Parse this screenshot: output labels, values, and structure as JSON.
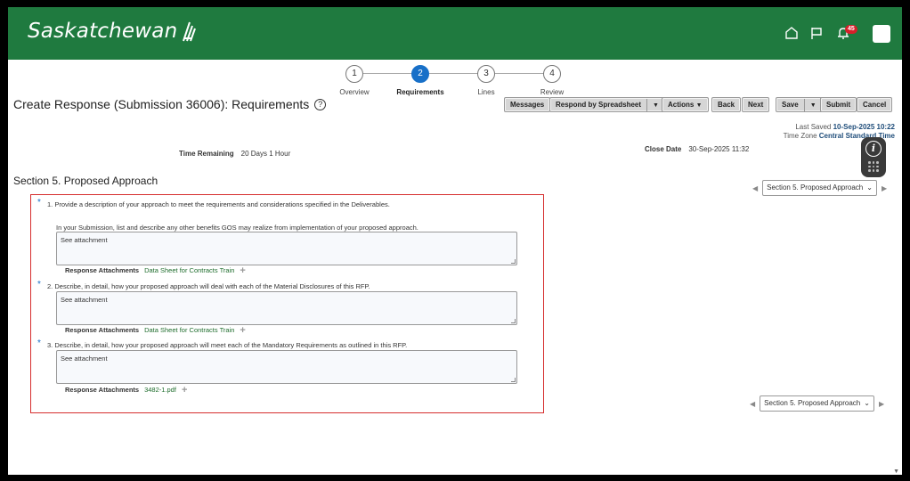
{
  "header": {
    "brand": "Saskatchewan",
    "notification_count": "45",
    "bg_color": "#1f7a3f"
  },
  "train": {
    "steps": [
      {
        "number": "1",
        "label": "Overview"
      },
      {
        "number": "2",
        "label": "Requirements"
      },
      {
        "number": "3",
        "label": "Lines"
      },
      {
        "number": "4",
        "label": "Review"
      }
    ],
    "active_index": 1
  },
  "page": {
    "title": "Create Response (Submission 36006): Requirements",
    "help_glyph": "?"
  },
  "toolbar": {
    "messages": "Messages",
    "respond_by_spreadsheet": "Respond by Spreadsheet",
    "actions": "Actions",
    "back": "Back",
    "next": "Next",
    "save": "Save",
    "submit": "Submit",
    "cancel": "Cancel"
  },
  "status": {
    "last_saved_label": "Last Saved",
    "last_saved_value": "10-Sep-2025 10:22",
    "time_zone_label": "Time Zone",
    "time_zone_value": "Central Standard Time",
    "time_remaining_label": "Time Remaining",
    "time_remaining_value": "20 Days 1 Hour",
    "close_date_label": "Close Date",
    "close_date_value": "30-Sep-2025 11:32"
  },
  "section": {
    "title": "Section 5. Proposed Approach",
    "selector_value": "Section 5. Proposed Approach"
  },
  "questions": [
    {
      "number": "1.",
      "text": "Provide a description of your approach to meet the requirements and considerations specified in the Deliverables.",
      "subtext": "In your Submission, list and describe any other benefits GOS may realize from implementation of your proposed approach.",
      "response": "See attachment",
      "attachments_label": "Response Attachments",
      "attachment": "Data Sheet for Contracts Train"
    },
    {
      "number": "2.",
      "text": "Describe, in detail, how your proposed approach will deal with each of the Material Disclosures of this RFP.",
      "subtext": "",
      "response": "See attachment",
      "attachments_label": "Response Attachments",
      "attachment": "Data Sheet for Contracts Train"
    },
    {
      "number": "3.",
      "text": "Describe, in detail, how your proposed approach will meet each of the Mandatory Requirements as outlined in this RFP.",
      "subtext": "",
      "response": "See attachment",
      "attachments_label": "Response Attachments",
      "attachment": "3482-1.pdf"
    }
  ],
  "icons": [
    "home-icon",
    "flag-icon",
    "bell-icon",
    "info-icon",
    "help-icon",
    "plus-icon",
    "caret-down-icon",
    "arrow-left-icon",
    "arrow-right-icon"
  ],
  "colors": {
    "active_step": "#1870c8",
    "highlight_border": "#d62e2e",
    "link": "#1f6d2d"
  }
}
